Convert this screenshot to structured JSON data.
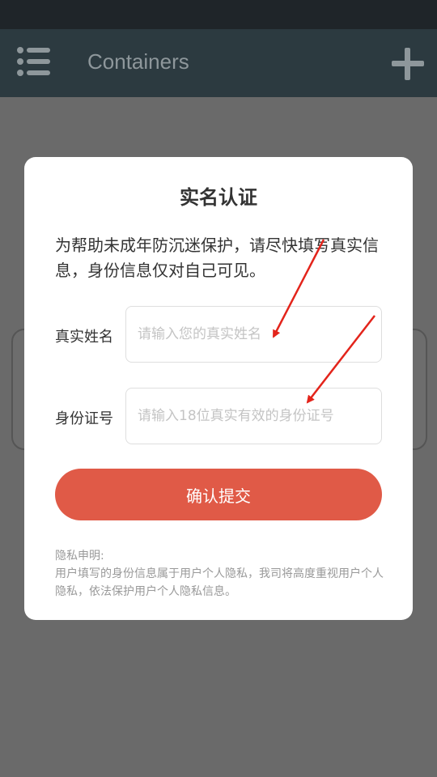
{
  "app_bar": {
    "title": "Containers",
    "menu_icon": "list-menu-icon",
    "add_icon": "plus-icon",
    "background": "#2c3a40"
  },
  "dialog": {
    "title": "实名认证",
    "description": "为帮助未成年防沉迷保护，请尽快填写真实信息，身份信息仅对自己可见。",
    "name_field": {
      "label": "真实姓名",
      "placeholder": "请输入您的真实姓名",
      "value": ""
    },
    "id_field": {
      "label": "身份证号",
      "placeholder": "请输入18位真实有效的身份证号",
      "value": ""
    },
    "submit_label": "确认提交",
    "submit_color": "#e05a47",
    "privacy_title": "隐私申明:",
    "privacy_text": "用户填写的身份信息属于用户个人隐私，我司将高度重视用户个人隐私，依法保护用户个人隐私信息。"
  },
  "annotation_color": "#e3241b"
}
